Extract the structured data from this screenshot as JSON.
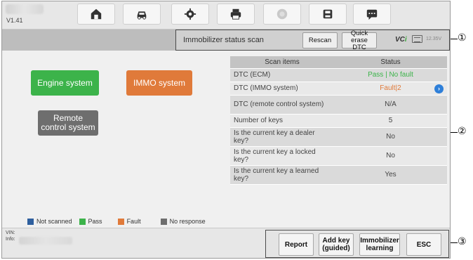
{
  "app": {
    "version": "V1.41"
  },
  "topbar": {
    "buttons": [
      {
        "name": "home-button",
        "icon": "home-icon"
      },
      {
        "name": "vehicle-button",
        "icon": "vehicle-icon"
      },
      {
        "name": "settings-button",
        "icon": "gear-icon"
      },
      {
        "name": "print-button",
        "icon": "printer-icon"
      },
      {
        "name": "help-button",
        "icon": "help-icon"
      },
      {
        "name": "save-button",
        "icon": "save-icon"
      },
      {
        "name": "message-button",
        "icon": "message-icon"
      }
    ]
  },
  "status_strip": {
    "title": "Immobilizer status scan",
    "rescan_label": "Rescan",
    "quick_erase_line1": "Quick erase",
    "quick_erase_line2": "DTC",
    "vci_prefix": "VC",
    "vci_suffix": "i",
    "voltage": "12.35V"
  },
  "systems": {
    "engine": "Engine system",
    "immo": "IMMO system",
    "remote_line1": "Remote",
    "remote_line2": "control system"
  },
  "table": {
    "headers": [
      "Scan items",
      "Status"
    ],
    "rows": [
      {
        "item": "DTC (ECM)",
        "status": "Pass | No fault"
      },
      {
        "item": "DTC (IMMO system)",
        "status": "Fault|2"
      },
      {
        "item": "DTC (remote control system)",
        "status": "N/A"
      },
      {
        "item": "Number of keys",
        "status": "5"
      },
      {
        "item": "Is the current key a dealer key?",
        "status": "No"
      },
      {
        "item": "Is the current key a locked key?",
        "status": "No"
      },
      {
        "item": "Is the current key a learned key?",
        "status": "Yes"
      }
    ]
  },
  "legend": [
    {
      "label": "Not scanned",
      "color": "#2e5f9e"
    },
    {
      "label": "Pass",
      "color": "#3cb34a"
    },
    {
      "label": "Fault",
      "color": "#e07a3a"
    },
    {
      "label": "No response",
      "color": "#6e6e6e"
    }
  ],
  "colors": {
    "pass": "#3cb34a",
    "fault": "#e07a3a",
    "no_response": "#6e6e6e",
    "pass_text": "#3cb34a",
    "fault_text": "#e07a3a"
  },
  "bottom": {
    "vin_label": "VIN:",
    "info_label": "Info:",
    "report_label": "Report",
    "add_key_line1": "Add key",
    "add_key_line2": "(guided)",
    "immobilizer_line1": "Immobilizer",
    "immobilizer_line2": "learning",
    "esc_label": "ESC"
  },
  "callouts": [
    "①",
    "②",
    "③"
  ]
}
